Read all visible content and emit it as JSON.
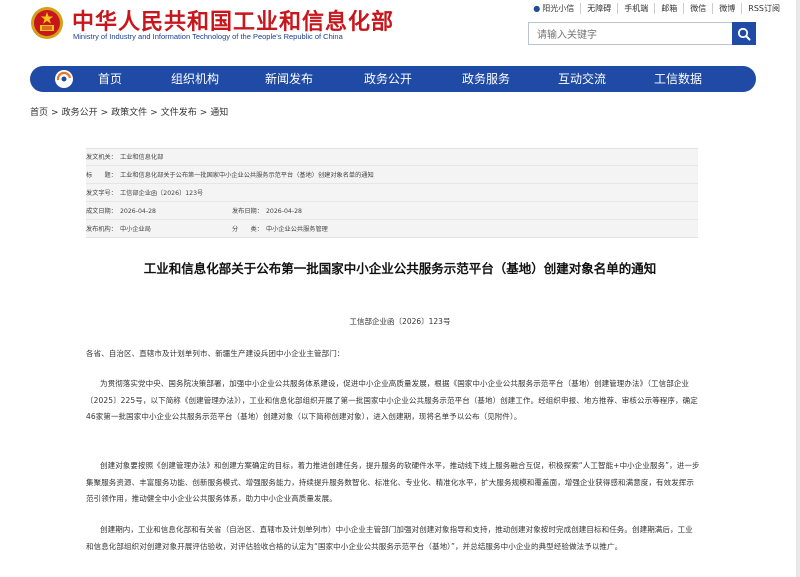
{
  "header": {
    "title": "中华人民共和国工业和信息化部",
    "subtitle": "Ministry of Industry and Information Technology of the People's Republic of China",
    "links": [
      {
        "label": "阳光小信",
        "icon": "person-icon"
      },
      {
        "label": "无障碍",
        "icon": "accessibility-icon"
      },
      {
        "label": "手机端",
        "icon": "mobile-icon"
      },
      {
        "label": "邮箱",
        "icon": "mail-icon"
      },
      {
        "label": "微信",
        "icon": "wechat-icon"
      },
      {
        "label": "微博",
        "icon": "weibo-icon"
      },
      {
        "label": "RSS订阅",
        "icon": "rss-icon"
      }
    ],
    "search_placeholder": "请输入关键字"
  },
  "nav": {
    "items": [
      "首页",
      "组织机构",
      "新闻发布",
      "政务公开",
      "政务服务",
      "互动交流",
      "工信数据"
    ]
  },
  "breadcrumb": [
    "首页",
    "政务公开",
    "政策文件",
    "文件发布",
    "通知"
  ],
  "meta": {
    "issuer_label": "发文机关：",
    "issuer": "工业和信息化部",
    "title_label": "标　　题：",
    "title": "工业和信息化部关于公布第一批国家中小企业公共服务示范平台（基地）创建对象名单的通知",
    "doc_no_label": "发文字号：",
    "doc_no": "工信部企业函〔2026〕123号",
    "written_label": "成文日期：",
    "written": "2026-04-28",
    "published_label": "发布日期：",
    "published": "2026-04-28",
    "publisher_label": "发布机构：",
    "publisher": "中小企业局",
    "category_label": "分　　类：",
    "category": "中小企业公共服务管理"
  },
  "document": {
    "title": "工业和信息化部关于公布第一批国家中小企业公共服务示范平台（基地）创建对象名单的通知",
    "number": "工信部企业函〔2026〕123号",
    "salutation": "各省、自治区、直辖市及计划单列市、新疆生产建设兵团中小企业主管部门：",
    "paragraphs": [
      "为贯彻落实党中央、国务院决策部署，加强中小企业公共服务体系建设，促进中小企业高质量发展，根据《国家中小企业公共服务示范平台（基地）创建管理办法》（工信部企业〔2025〕225号，以下简称《创建管理办法》），工业和信息化部组织开展了第一批国家中小企业公共服务示范平台（基地）创建工作。经组织申报、地方推荐、审核公示等程序，确定46家第一批国家中小企业公共服务示范平台（基地）创建对象（以下简称创建对象），进入创建期，现将名单予以公布（见附件）。",
      "创建对象要按照《创建管理办法》和创建方案确定的目标，着力推进创建任务，提升服务的软硬件水平，推动线下线上服务融合互促，积极探索“人工智能+中小企业服务”，进一步集聚服务资源、丰富服务功能、创新服务模式、增强服务能力，持续提升服务数智化、标准化、专业化、精准化水平，扩大服务规模和覆盖面，增强企业获得感和满意度，有效发挥示范引领作用，推动健全中小企业公共服务体系，助力中小企业高质量发展。",
      "创建期内，工业和信息化部和有关省（自治区、直辖市及计划单列市）中小企业主管部门加强对创建对象指导和支持，推动创建对象按时完成创建目标和任务。创建期满后，工业和信息化部组织对创建对象开展评估验收，对评估验收合格的认定为“国家中小企业公共服务示范平台（基地）”，并总结服务中小企业的典型经验做法予以推广。"
    ]
  },
  "colors": {
    "brand_red": "#c8161d",
    "nav_blue": "#1f4aa5",
    "meta_bg": "#f4f4f4"
  }
}
